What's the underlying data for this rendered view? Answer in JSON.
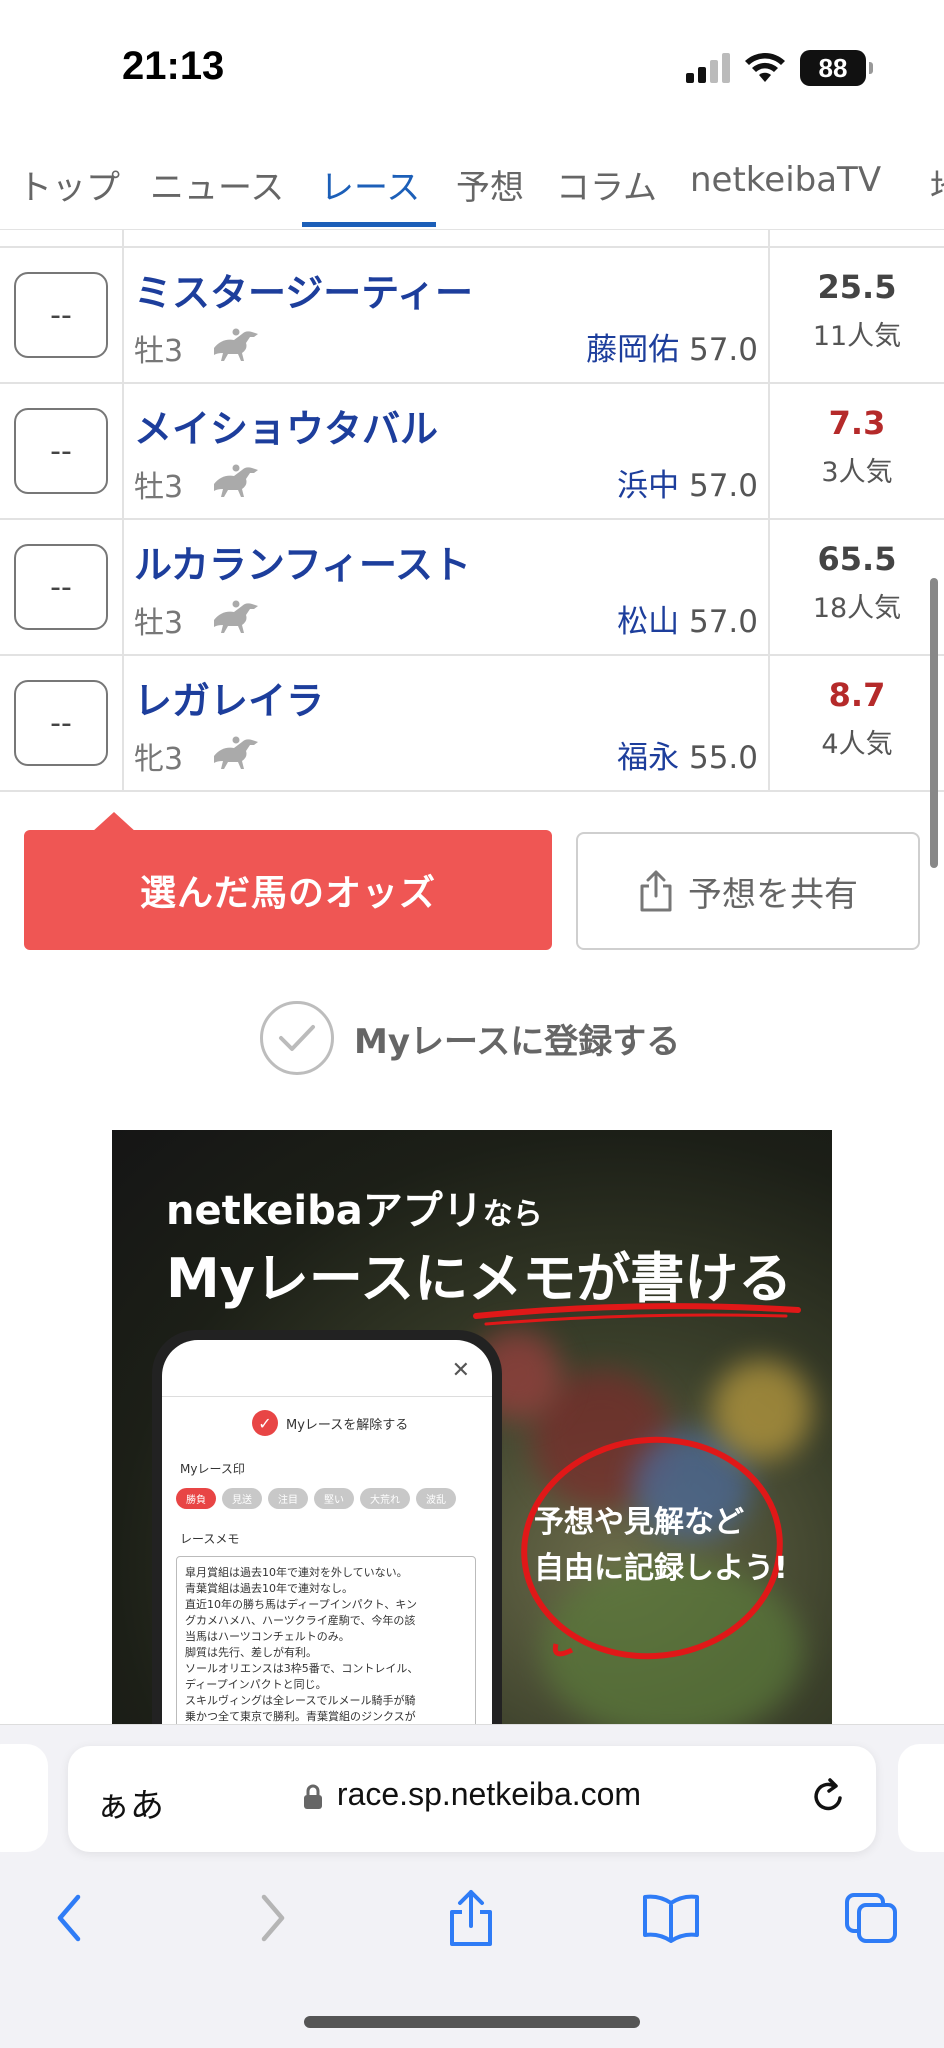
{
  "status_bar": {
    "time": "21:13",
    "battery": "88"
  },
  "nav": {
    "tabs": [
      {
        "label": "トップ"
      },
      {
        "label": "ニュース"
      },
      {
        "label": "レース"
      },
      {
        "label": "予想"
      },
      {
        "label": "コラム"
      },
      {
        "label": "netkeibaTV"
      },
      {
        "label": "地"
      }
    ],
    "active": "レース"
  },
  "horses": [
    {
      "mark": "--",
      "name": "ミスタージーティー",
      "sex_age": "牡3",
      "jockey": "藤岡佑",
      "weight": "57.0",
      "odds": "25.5",
      "popularity": "11人気",
      "favored": false
    },
    {
      "mark": "--",
      "name": "メイショウタバル",
      "sex_age": "牡3",
      "jockey": "浜中",
      "weight": "57.0",
      "odds": "7.3",
      "popularity": "3人気",
      "favored": true
    },
    {
      "mark": "--",
      "name": "ルカランフィースト",
      "sex_age": "牡3",
      "jockey": "松山",
      "weight": "57.0",
      "odds": "65.5",
      "popularity": "18人気",
      "favored": false
    },
    {
      "mark": "--",
      "name": "レガレイラ",
      "sex_age": "牝3",
      "jockey": "福永",
      "weight": "55.0",
      "odds": "8.7",
      "popularity": "4人気",
      "favored": true
    }
  ],
  "actions": {
    "odds_button": "選んだ馬のオッズ",
    "share_button": "予想を共有",
    "myrace_label": "Myレースに登録する"
  },
  "banner": {
    "line1_a": "netkeibaアプリ",
    "line1_b": "なら",
    "line2": "Myレースにメモが書ける",
    "phone_unregister": "Myレースを解除する",
    "phone_mark_label": "Myレース印",
    "phone_chips": [
      "勝負",
      "見送",
      "注目",
      "堅い",
      "大荒れ",
      "波乱"
    ],
    "phone_memo_label": "レースメモ",
    "phone_memo_lines": [
      "皐月賞組は過去10年で連対を外していない。",
      "青葉賞組は過去10年で連対なし。",
      "直近10年の勝ち馬はディープインパクト、キン",
      "グカメハメハ、ハーツクライ産駒で、今年の該",
      "当馬はハーツコンチェルトのみ。",
      "脚質は先行、差しが有利。",
      "ソールオリエンスは3枠5番で、コントレイル、",
      "ディープインパクトと同じ。",
      "スキルヴィングは全レースでルメール騎手が騎",
      "乗かつ全て東京で勝利。青葉賞組のジンクスが"
    ],
    "bubble_line1": "予想や見解など",
    "bubble_line2": "自由に記録しよう!"
  },
  "browser": {
    "aa_label": "ぁあ",
    "url": "race.sp.netkeiba.com"
  },
  "colors": {
    "accent_blue": "#1c5fb8",
    "horse_name": "#1d3e9c",
    "odds_red": "#b52a2a",
    "button_red": "#ef5654"
  }
}
